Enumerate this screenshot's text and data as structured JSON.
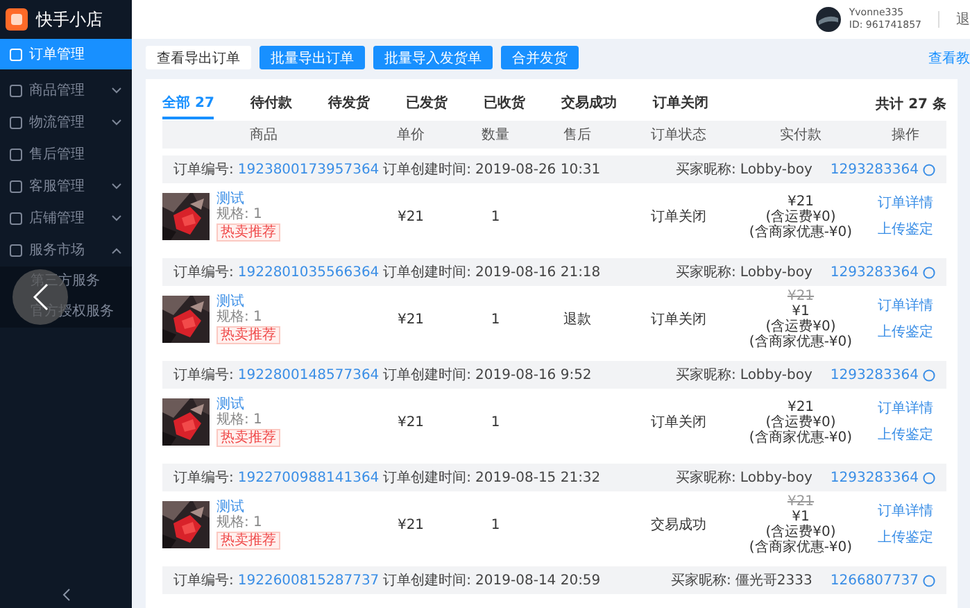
{
  "brand": {
    "name": "快手小店"
  },
  "sidebar": {
    "items": [
      {
        "label": "订单管理",
        "selected": true
      },
      {
        "label": "商品管理",
        "selected": false,
        "expanded": false
      },
      {
        "label": "物流管理",
        "selected": false,
        "expanded": false
      },
      {
        "label": "售后管理",
        "selected": false
      },
      {
        "label": "客服管理",
        "selected": false,
        "expanded": false
      },
      {
        "label": "店铺管理",
        "selected": false,
        "expanded": false
      },
      {
        "label": "服务市场",
        "selected": false,
        "expanded": true,
        "children": [
          {
            "label": "第三方服务",
            "selected": false
          },
          {
            "label": "官方授权服务",
            "selected": false
          }
        ]
      }
    ]
  },
  "user": {
    "name": "Yvonne335",
    "id": "ID: 961741857",
    "logout": "退"
  },
  "toolbar": {
    "buttons": [
      {
        "label": "查看导出订单",
        "kind": "plain"
      },
      {
        "label": "批量导出订单",
        "kind": "primary"
      },
      {
        "label": "批量导入发货单",
        "kind": "primary"
      },
      {
        "label": "合并发货",
        "kind": "primary"
      }
    ],
    "help_link": "查看教"
  },
  "tabs": [
    {
      "label": "全部 27",
      "selected": true
    },
    {
      "label": "待付款",
      "selected": false
    },
    {
      "label": "待发货",
      "selected": false
    },
    {
      "label": "已发货",
      "selected": false
    },
    {
      "label": "已收货",
      "selected": false
    },
    {
      "label": "交易成功",
      "selected": false
    },
    {
      "label": "订单关闭",
      "selected": false
    }
  ],
  "total": "共计 27 条",
  "columns": [
    "商品",
    "单价",
    "数量",
    "售后",
    "订单状态",
    "实付款",
    "操作"
  ],
  "orders": [
    {
      "order_no_label": "订单编号:",
      "order_no": "1923800173957364",
      "created_label": "订单创建时间:",
      "created": "2019-08-26 10:31",
      "buyer_label": "买家昵称:",
      "buyer": "Lobby-boy",
      "buyer_id": "1293283364",
      "product": {
        "name": "测试",
        "spec": "规格: 1",
        "tag": "热卖推荐"
      },
      "unit_price": "¥21",
      "qty": "1",
      "status": "订单关闭",
      "paid": [
        {
          "text": "¥21",
          "struck": false
        },
        {
          "text": "(含运费¥0)",
          "struck": false
        },
        {
          "text": "(含商家优惠-¥0)",
          "struck": false
        }
      ],
      "actions": [
        "订单详情",
        "上传鉴定"
      ]
    },
    {
      "order_no_label": "订单编号:",
      "order_no": "1922801035566364",
      "created_label": "订单创建时间:",
      "created": "2019-08-16 21:18",
      "buyer_label": "买家昵称:",
      "buyer": "Lobby-boy",
      "buyer_id": "1293283364",
      "product": {
        "name": "测试",
        "spec": "规格: 1",
        "tag": "热卖推荐"
      },
      "unit_price": "¥21",
      "qty": "1",
      "after_sale": "退款",
      "status": "订单关闭",
      "paid": [
        {
          "text": "¥21",
          "struck": true
        },
        {
          "text": "¥1",
          "struck": false
        },
        {
          "text": "(含运费¥0)",
          "struck": false
        },
        {
          "text": "(含商家优惠-¥0)",
          "struck": false
        }
      ],
      "actions": [
        "订单详情",
        "上传鉴定"
      ]
    },
    {
      "order_no_label": "订单编号:",
      "order_no": "1922800148577364",
      "created_label": "订单创建时间:",
      "created": "2019-08-16 9:52",
      "buyer_label": "买家昵称:",
      "buyer": "Lobby-boy",
      "buyer_id": "1293283364",
      "product": {
        "name": "测试",
        "spec": "规格: 1",
        "tag": "热卖推荐"
      },
      "unit_price": "¥21",
      "qty": "1",
      "status": "订单关闭",
      "paid": [
        {
          "text": "¥21",
          "struck": false
        },
        {
          "text": "(含运费¥0)",
          "struck": false
        },
        {
          "text": "(含商家优惠-¥0)",
          "struck": false
        }
      ],
      "actions": [
        "订单详情",
        "上传鉴定"
      ]
    },
    {
      "order_no_label": "订单编号:",
      "order_no": "1922700988141364",
      "created_label": "订单创建时间:",
      "created": "2019-08-15 21:32",
      "buyer_label": "买家昵称:",
      "buyer": "Lobby-boy",
      "buyer_id": "1293283364",
      "product": {
        "name": "测试",
        "spec": "规格: 1",
        "tag": "热卖推荐"
      },
      "unit_price": "¥21",
      "qty": "1",
      "status": "交易成功",
      "paid": [
        {
          "text": "¥21",
          "struck": true
        },
        {
          "text": "¥1",
          "struck": false
        },
        {
          "text": "(含运费¥0)",
          "struck": false
        },
        {
          "text": "(含商家优惠-¥0)",
          "struck": false
        }
      ],
      "actions": [
        "订单详情",
        "上传鉴定"
      ]
    },
    {
      "order_no_label": "订单编号:",
      "order_no": "1922600815287737",
      "created_label": "订单创建时间:",
      "created": "2019-08-14 20:59",
      "buyer_label": "买家昵称:",
      "buyer": "僵光哥2333",
      "buyer_id": "1266807737"
    }
  ]
}
